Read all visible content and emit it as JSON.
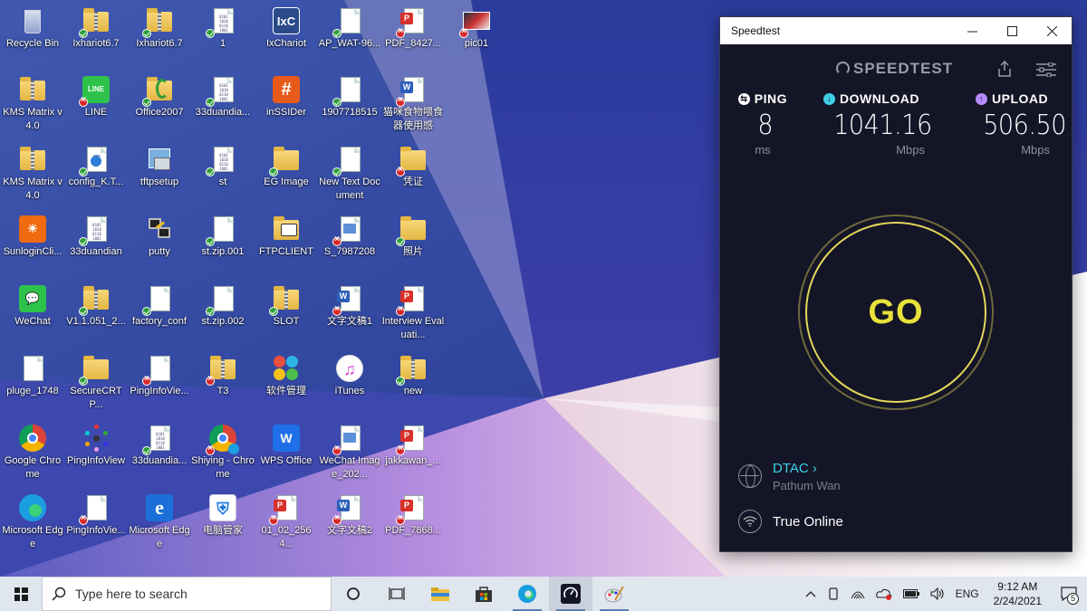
{
  "desktop": {
    "icons": [
      {
        "label": "Recycle Bin",
        "kind": "bin",
        "badge": ""
      },
      {
        "label": "Ixhariot6.7",
        "kind": "zipfolder",
        "badge": "ok"
      },
      {
        "label": "Ixhariot6.7",
        "kind": "zipfolder",
        "badge": "ok"
      },
      {
        "label": "1",
        "kind": "binary",
        "badge": "ok"
      },
      {
        "label": "IxChariot",
        "kind": "app-ixc",
        "badge": ""
      },
      {
        "label": "AP_WAT-96...",
        "kind": "page",
        "badge": "ok"
      },
      {
        "label": "PDF_8427...",
        "kind": "pdf",
        "badge": "err"
      },
      {
        "label": "pic01",
        "kind": "pic",
        "badge": "err"
      },
      {
        "label": "KMS Matrix v4.0",
        "kind": "zipfolder",
        "badge": ""
      },
      {
        "label": "LINE",
        "kind": "app-line",
        "badge": "err"
      },
      {
        "label": "Office2007",
        "kind": "folder-office",
        "badge": "ok"
      },
      {
        "label": "33duandia...",
        "kind": "binary",
        "badge": "ok"
      },
      {
        "label": "inSSIDer",
        "kind": "app-inssider",
        "badge": ""
      },
      {
        "label": "1907718515",
        "kind": "page",
        "badge": "ok"
      },
      {
        "label": "猫咪食物喂食器使用感",
        "kind": "word",
        "badge": "err"
      },
      {
        "label": "KMS Matrix v4.0",
        "kind": "zipfolder",
        "badge": ""
      },
      {
        "label": "config_K.T...",
        "kind": "config",
        "badge": "ok"
      },
      {
        "label": "tftpsetup",
        "kind": "setup",
        "badge": ""
      },
      {
        "label": "st",
        "kind": "binary",
        "badge": "ok"
      },
      {
        "label": "EG Image",
        "kind": "folder",
        "badge": "ok"
      },
      {
        "label": "New Text Document",
        "kind": "page",
        "badge": "ok"
      },
      {
        "label": "凭证",
        "kind": "folder",
        "badge": "err"
      },
      {
        "label": "SunloginCli...",
        "kind": "app-sunlogin",
        "badge": ""
      },
      {
        "label": "33duandian",
        "kind": "binary",
        "badge": "ok"
      },
      {
        "label": "putty",
        "kind": "putty",
        "badge": ""
      },
      {
        "label": "st.zip.001",
        "kind": "page",
        "badge": "ok"
      },
      {
        "label": "FTPCLIENT",
        "kind": "ftp",
        "badge": ""
      },
      {
        "label": "S_7987208",
        "kind": "image",
        "badge": "err"
      },
      {
        "label": "照片",
        "kind": "folder",
        "badge": "ok"
      },
      {
        "label": "WeChat",
        "kind": "app-wechat",
        "badge": ""
      },
      {
        "label": "V1.1.051_2...",
        "kind": "zipfolder",
        "badge": "ok"
      },
      {
        "label": "factory_conf",
        "kind": "page",
        "badge": "ok"
      },
      {
        "label": "st.zip.002",
        "kind": "page",
        "badge": "ok"
      },
      {
        "label": "SLOT",
        "kind": "zipfolder",
        "badge": "ok"
      },
      {
        "label": "文字文稿1",
        "kind": "word",
        "badge": "err"
      },
      {
        "label": "Interview Evaluati...",
        "kind": "pdf",
        "badge": "err"
      },
      {
        "label": "pluge_1748",
        "kind": "page",
        "badge": ""
      },
      {
        "label": "SecureCRTP...",
        "kind": "folder",
        "badge": "ok"
      },
      {
        "label": "PingInfoVie...",
        "kind": "page",
        "badge": "err"
      },
      {
        "label": "T3",
        "kind": "zipfolder",
        "badge": "err"
      },
      {
        "label": "软件管理",
        "kind": "app-soft",
        "badge": ""
      },
      {
        "label": "iTunes",
        "kind": "app-itunes",
        "badge": ""
      },
      {
        "label": "new",
        "kind": "zipfolder",
        "badge": "ok"
      },
      {
        "label": "Google Chrome",
        "kind": "app-chrome",
        "badge": ""
      },
      {
        "label": "PingInfoView",
        "kind": "app-ping",
        "badge": ""
      },
      {
        "label": "33duandia...",
        "kind": "binary",
        "badge": "ok"
      },
      {
        "label": "Shiying - Chrome",
        "kind": "app-chrome2",
        "badge": "err"
      },
      {
        "label": "WPS Office",
        "kind": "app-wps",
        "badge": ""
      },
      {
        "label": "WeChat Image_202...",
        "kind": "image",
        "badge": "err"
      },
      {
        "label": "jakkawan_...",
        "kind": "pdf",
        "badge": "err"
      },
      {
        "label": "Microsoft Edge",
        "kind": "app-edge",
        "badge": ""
      },
      {
        "label": "PingInfoVie...",
        "kind": "page",
        "badge": "err"
      },
      {
        "label": "Microsoft Edge",
        "kind": "app-ie",
        "badge": ""
      },
      {
        "label": "电脑管家",
        "kind": "app-pcmgr",
        "badge": ""
      },
      {
        "label": "01_02_2564...",
        "kind": "pdf",
        "badge": "err"
      },
      {
        "label": "文字文稿2",
        "kind": "word",
        "badge": "err"
      },
      {
        "label": "PDF_7868...",
        "kind": "pdf",
        "badge": "err"
      }
    ]
  },
  "speedtest": {
    "window_title": "Speedtest",
    "logo_text": "SPEEDTEST",
    "ping": {
      "label": "PING",
      "value": "8",
      "unit": "ms"
    },
    "download": {
      "label": "DOWNLOAD",
      "value": "1041.16",
      "unit": "Mbps"
    },
    "upload": {
      "label": "UPLOAD",
      "value": "506.50",
      "unit": "Mbps"
    },
    "go_label": "GO",
    "isp": {
      "name": "DTAC",
      "location": "Pathum Wan"
    },
    "network": {
      "name": "True Online"
    },
    "colors": {
      "go": "#e8e13a",
      "isp": "#3fd0e8",
      "ping_icon": "#ffffff",
      "download_icon": "#3fd0e8",
      "upload_icon": "#b88cff"
    }
  },
  "taskbar": {
    "search_placeholder": "Type here to search",
    "language": "ENG",
    "time": "9:12 AM",
    "date": "2/24/2021",
    "notification_count": "5"
  }
}
